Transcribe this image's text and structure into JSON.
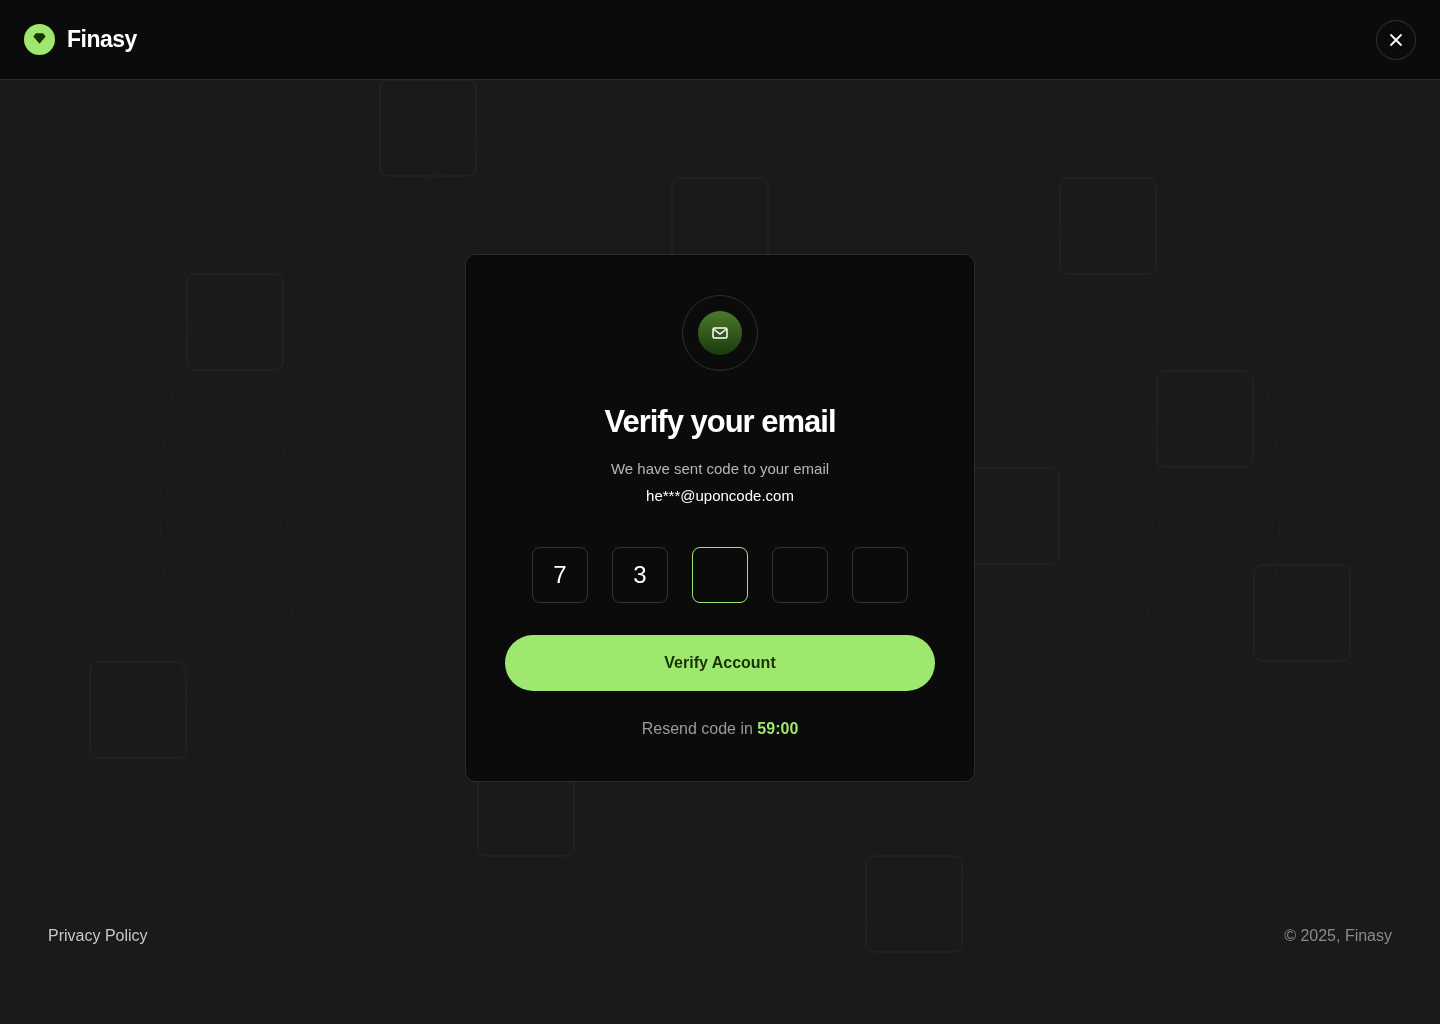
{
  "header": {
    "brand": "Finasy"
  },
  "dialog": {
    "title": "Verify your email",
    "message": "We have sent code to your email",
    "email": "he***@uponcode.com",
    "code": [
      {
        "value": "7",
        "focused": false
      },
      {
        "value": "3",
        "focused": false
      },
      {
        "focused": true
      },
      {
        "focused": false
      },
      {
        "focused": false
      }
    ],
    "button": "Verify Account",
    "resend_label": "Resend code in",
    "timer": "59:00"
  },
  "footer": {
    "link": "Privacy Policy",
    "copyright": "© 2025, Finasy"
  }
}
